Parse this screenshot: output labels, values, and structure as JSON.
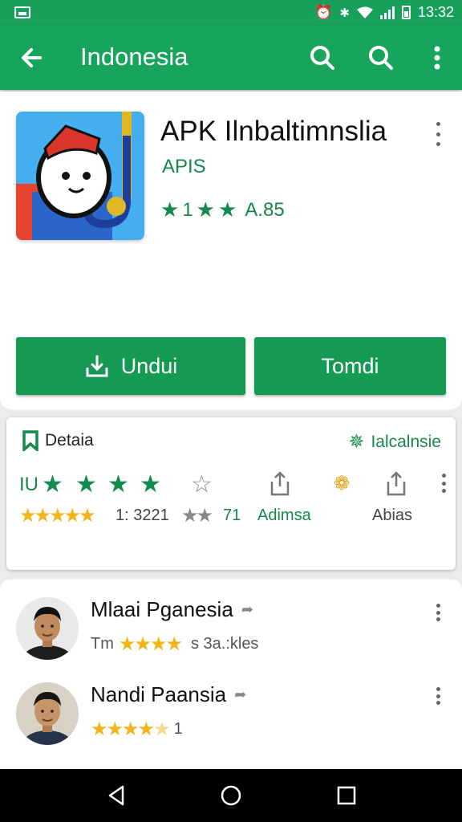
{
  "status_bar": {
    "time": "13:32"
  },
  "app_bar": {
    "title": "Indonesia"
  },
  "app": {
    "name": "APK Ilnbaltimnslia",
    "developer": "APIS",
    "rating_prefix": "1",
    "rating_value": "A.85"
  },
  "buttons": {
    "install_label": "Undui",
    "open_label": "Tomdi"
  },
  "details": {
    "label": "Detaia",
    "right_label": "Ialcalnsie",
    "row1_prefix": "IU",
    "row2_count": "1: 3221",
    "row2_score": "71",
    "row2_tag": "Adimsa",
    "row2_share": "Abias"
  },
  "reviews": [
    {
      "name": "Mlaai Pganesia",
      "meta_prefix": "Tm",
      "meta_text": "s 3a.:kles"
    },
    {
      "name": "Nandi Paansia",
      "meta_suffix": "1"
    }
  ],
  "colors": {
    "primary": "#17a45c",
    "accent_green": "#17864a",
    "star_yellow": "#f2b418"
  }
}
